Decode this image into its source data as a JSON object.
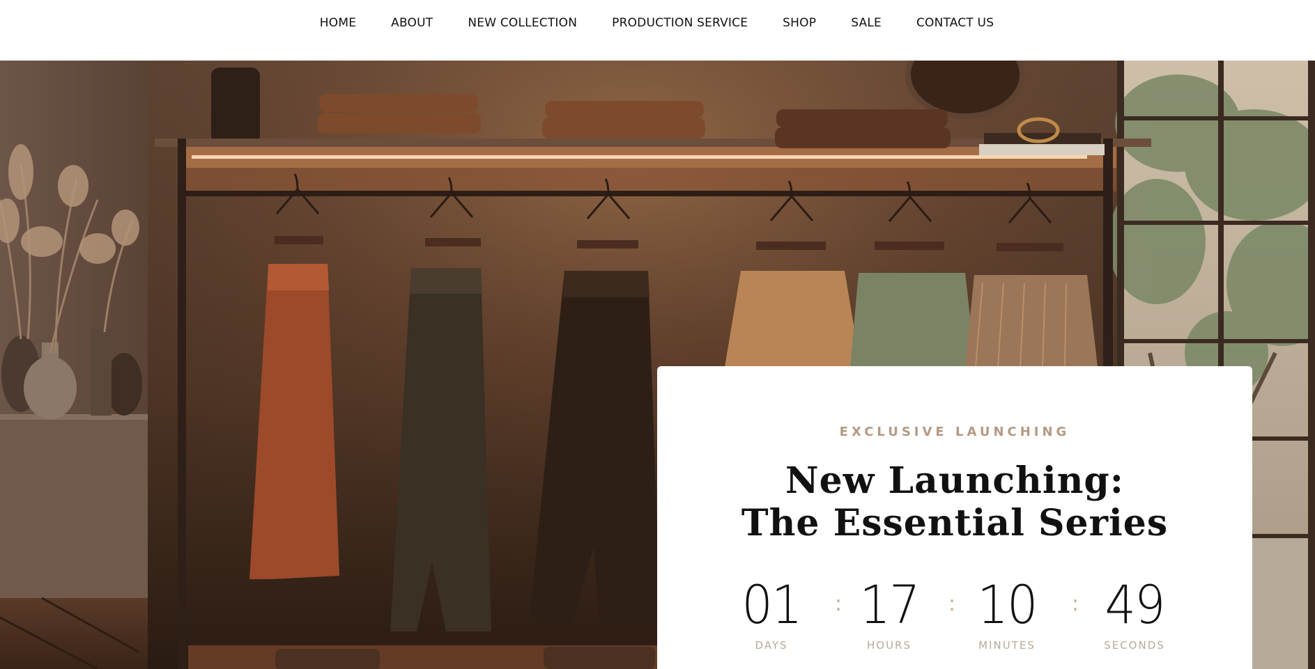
{
  "nav": {
    "items": [
      "HOME",
      "ABOUT",
      "NEW COLLECTION",
      "PRODUCTION SERVICE",
      "SHOP",
      "SALE",
      "CONTACT US"
    ]
  },
  "hero": {
    "image": "boutique-clothing-rack-photo"
  },
  "launch_card": {
    "eyebrow": "EXCLUSIVE LAUNCHING",
    "headline_line1": "New Launching:",
    "headline_line2": "The Essential Series",
    "separator": ":",
    "countdown": {
      "days": {
        "value": "01",
        "label": "DAYS"
      },
      "hours": {
        "value": "17",
        "label": "HOURS"
      },
      "minutes": {
        "value": "10",
        "label": "MINUTES"
      },
      "seconds": {
        "value": "49",
        "label": "SECONDS"
      }
    }
  },
  "colors": {
    "accent": "#b49a82",
    "text": "#111111",
    "label": "#b9a898",
    "scene_base": "#4a3426"
  }
}
